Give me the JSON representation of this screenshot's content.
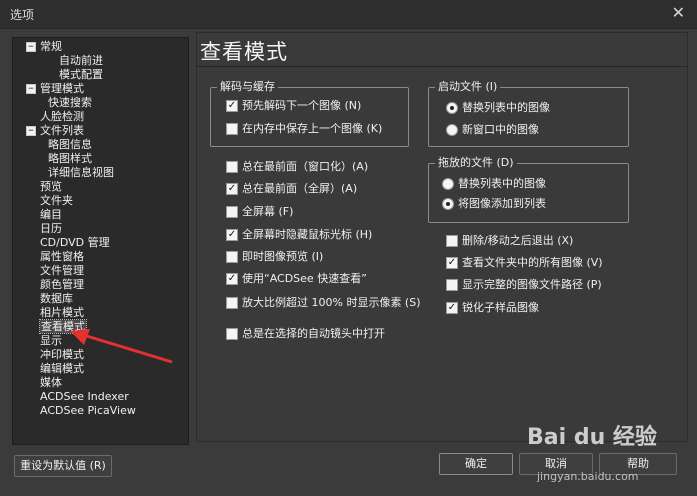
{
  "window": {
    "title": "选项",
    "close_glyph": "✕"
  },
  "tree": [
    {
      "label": "常规",
      "level": 0,
      "expander": "−"
    },
    {
      "label": "自动前进",
      "level": 2
    },
    {
      "label": "模式配置",
      "level": 2
    },
    {
      "label": "管理模式",
      "level": 0,
      "expander": "−"
    },
    {
      "label": "快速搜索",
      "level": 1
    },
    {
      "label": "人脸检测",
      "level": 0
    },
    {
      "label": "文件列表",
      "level": 0,
      "expander": "−"
    },
    {
      "label": "略图信息",
      "level": 1
    },
    {
      "label": "略图样式",
      "level": 1
    },
    {
      "label": "详细信息视图",
      "level": 1
    },
    {
      "label": "预览",
      "level": 0
    },
    {
      "label": "文件夹",
      "level": 0
    },
    {
      "label": "编目",
      "level": 0
    },
    {
      "label": "日历",
      "level": 0
    },
    {
      "label": "CD/DVD 管理",
      "level": 0
    },
    {
      "label": "属性窗格",
      "level": 0
    },
    {
      "label": "文件管理",
      "level": 0
    },
    {
      "label": "颜色管理",
      "level": 0
    },
    {
      "label": "数据库",
      "level": 0
    },
    {
      "label": "相片模式",
      "level": 0
    },
    {
      "label": "查看模式",
      "level": 0,
      "selected": true
    },
    {
      "label": "显示",
      "level": 0
    },
    {
      "label": "冲印模式",
      "level": 0
    },
    {
      "label": "编辑模式",
      "level": 0
    },
    {
      "label": "媒体",
      "level": 0
    },
    {
      "label": "ACDSee Indexer",
      "level": 0
    },
    {
      "label": "ACDSee PicaView",
      "level": 0
    }
  ],
  "panel": {
    "title": "查看模式",
    "decode_group": {
      "legend": "解码与缓存",
      "options": [
        {
          "label": "预先解码下一个图像 (N)",
          "checked": true
        },
        {
          "label": "在内存中保存上一个图像 (K)",
          "checked": false
        }
      ]
    },
    "startup_group": {
      "legend": "启动文件 (I)",
      "options": [
        {
          "label": "替换列表中的图像",
          "selected": true
        },
        {
          "label": "新窗口中的图像",
          "selected": false
        }
      ]
    },
    "drop_group": {
      "legend": "拖放的文件 (D)",
      "options": [
        {
          "label": "替换列表中的图像",
          "selected": false
        },
        {
          "label": "将图像添加到列表",
          "selected": true
        }
      ]
    },
    "left_options": [
      {
        "label": "总在最前面（窗口化）(A)",
        "checked": false
      },
      {
        "label": "总在最前面（全屏）(A)",
        "checked": true
      },
      {
        "label": "全屏幕 (F)",
        "checked": false
      },
      {
        "label": "全屏幕时隐藏鼠标光标 (H)",
        "checked": true
      },
      {
        "label": "即时图像预览 (I)",
        "checked": false
      },
      {
        "label": "使用“ACDSee 快速查看”",
        "checked": true
      },
      {
        "label": "放大比例超过 100% 时显示像素 (S)",
        "checked": false
      },
      {
        "label": "总是在选择的自动镜头中打开",
        "checked": false
      }
    ],
    "right_options": [
      {
        "label": "删除/移动之后退出 (X)",
        "checked": false
      },
      {
        "label": "查看文件夹中的所有图像 (V)",
        "checked": true
      },
      {
        "label": "显示完整的图像文件路径 (P)",
        "checked": false
      },
      {
        "label": "锐化子样品图像",
        "checked": true
      }
    ]
  },
  "buttons": {
    "reset": "重设为默认值 (R)",
    "ok": "确定",
    "cancel": "取消",
    "help": "帮助"
  },
  "watermark": {
    "logo": "Bai du 经验",
    "url": "jingyan.baidu.com"
  },
  "colors": {
    "background": "#3b3b3b",
    "tree_bg": "#2a2a2a",
    "arrow": "#e53030"
  }
}
